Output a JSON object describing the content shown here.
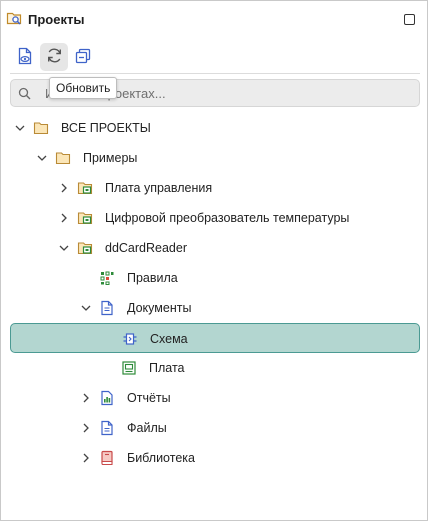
{
  "panel": {
    "title": "Проекты",
    "title_icon": "folder-search-icon"
  },
  "toolbar": {
    "buttons": [
      {
        "icon": "document-view-icon"
      },
      {
        "icon": "refresh-icon"
      },
      {
        "icon": "collapse-all-icon"
      }
    ],
    "tooltip": "Обновить"
  },
  "search": {
    "placeholder": "Искать в проектах...",
    "visible_text": "Искать в проектах..."
  },
  "tree": [
    {
      "label": "ВСЕ ПРОЕКТЫ",
      "icon": "folder-icon",
      "expanded": true,
      "level": 0
    },
    {
      "label": "Примеры",
      "icon": "folder-icon",
      "expanded": true,
      "level": 1
    },
    {
      "label": "Плата управления",
      "icon": "project-folder-icon",
      "expanded": false,
      "level": 2
    },
    {
      "label": "Цифровой преобразователь температуры",
      "icon": "project-folder-icon",
      "expanded": false,
      "level": 2
    },
    {
      "label": "ddCardReader",
      "icon": "project-folder-icon",
      "expanded": true,
      "level": 2
    },
    {
      "label": "Правила",
      "icon": "rules-icon",
      "level": 3
    },
    {
      "label": "Документы",
      "icon": "documents-icon",
      "expanded": true,
      "level": 3
    },
    {
      "label": "Схема",
      "icon": "schematic-icon",
      "level": 4,
      "selected": true
    },
    {
      "label": "Плата",
      "icon": "board-icon",
      "level": 4
    },
    {
      "label": "Отчёты",
      "icon": "reports-icon",
      "expanded": false,
      "level": 3
    },
    {
      "label": "Файлы",
      "icon": "file-icon",
      "expanded": false,
      "level": 3
    },
    {
      "label": "Библиотека",
      "icon": "library-icon",
      "expanded": false,
      "level": 3
    }
  ],
  "colors": {
    "selection_bg": "#b3d6d0",
    "selection_border": "#4b9a93",
    "folder": "#e9c98a",
    "project_green": "#2e8b3a",
    "doc_blue": "#3f63c9",
    "library_red": "#c84a4a"
  }
}
